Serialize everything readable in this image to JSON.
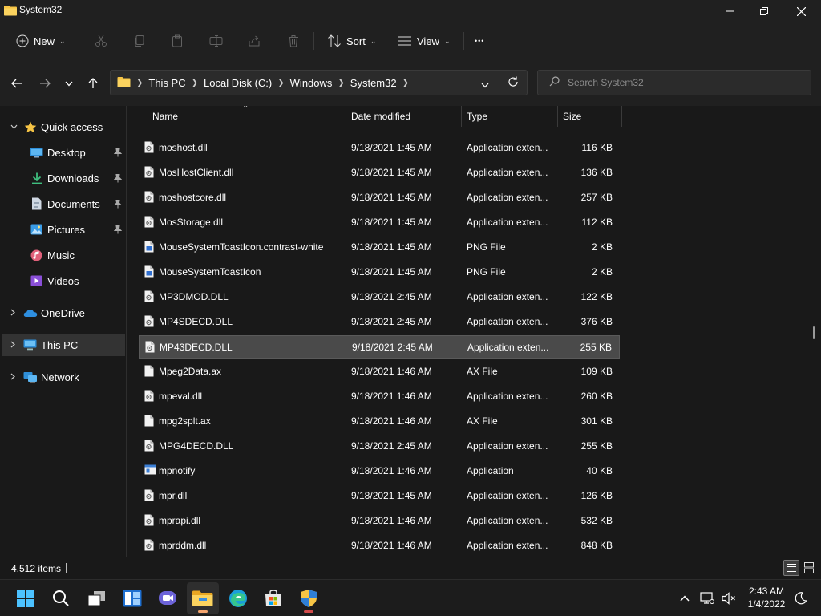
{
  "window": {
    "title": "System32"
  },
  "toolbar": {
    "new_label": "New",
    "sort_label": "Sort",
    "view_label": "View",
    "more_label": "•••"
  },
  "address": {
    "breadcrumbs": [
      "This PC",
      "Local Disk (C:)",
      "Windows",
      "System32"
    ]
  },
  "search": {
    "placeholder": "Search System32"
  },
  "sidebar": {
    "quick_access": "Quick access",
    "items": [
      {
        "label": "Desktop",
        "icon": "desktop-icon",
        "pinned": true
      },
      {
        "label": "Downloads",
        "icon": "download-icon",
        "pinned": true
      },
      {
        "label": "Documents",
        "icon": "documents-icon",
        "pinned": true
      },
      {
        "label": "Pictures",
        "icon": "pictures-icon",
        "pinned": true
      },
      {
        "label": "Music",
        "icon": "music-icon",
        "pinned": false
      },
      {
        "label": "Videos",
        "icon": "videos-icon",
        "pinned": false
      }
    ],
    "onedrive": "OneDrive",
    "this_pc": "This PC",
    "network": "Network"
  },
  "columns": {
    "name": "Name",
    "date": "Date modified",
    "type": "Type",
    "size": "Size"
  },
  "files": [
    {
      "name": "moshost.dll",
      "date": "9/18/2021 1:45 AM",
      "type": "Application exten...",
      "size": "116 KB",
      "icon": "dll-file-icon"
    },
    {
      "name": "MosHostClient.dll",
      "date": "9/18/2021 1:45 AM",
      "type": "Application exten...",
      "size": "136 KB",
      "icon": "dll-file-icon"
    },
    {
      "name": "moshostcore.dll",
      "date": "9/18/2021 1:45 AM",
      "type": "Application exten...",
      "size": "257 KB",
      "icon": "dll-file-icon"
    },
    {
      "name": "MosStorage.dll",
      "date": "9/18/2021 1:45 AM",
      "type": "Application exten...",
      "size": "112 KB",
      "icon": "dll-file-icon"
    },
    {
      "name": "MouseSystemToastIcon.contrast-white",
      "date": "9/18/2021 1:45 AM",
      "type": "PNG File",
      "size": "2 KB",
      "icon": "png-file-icon"
    },
    {
      "name": "MouseSystemToastIcon",
      "date": "9/18/2021 1:45 AM",
      "type": "PNG File",
      "size": "2 KB",
      "icon": "png-file-icon"
    },
    {
      "name": "MP3DMOD.DLL",
      "date": "9/18/2021 2:45 AM",
      "type": "Application exten...",
      "size": "122 KB",
      "icon": "dll-file-icon"
    },
    {
      "name": "MP4SDECD.DLL",
      "date": "9/18/2021 2:45 AM",
      "type": "Application exten...",
      "size": "376 KB",
      "icon": "dll-file-icon"
    },
    {
      "name": "MP43DECD.DLL",
      "date": "9/18/2021 2:45 AM",
      "type": "Application exten...",
      "size": "255 KB",
      "icon": "dll-file-icon",
      "selected": true
    },
    {
      "name": "Mpeg2Data.ax",
      "date": "9/18/2021 1:46 AM",
      "type": "AX File",
      "size": "109 KB",
      "icon": "ax-file-icon"
    },
    {
      "name": "mpeval.dll",
      "date": "9/18/2021 1:46 AM",
      "type": "Application exten...",
      "size": "260 KB",
      "icon": "dll-file-icon"
    },
    {
      "name": "mpg2splt.ax",
      "date": "9/18/2021 1:46 AM",
      "type": "AX File",
      "size": "301 KB",
      "icon": "ax-file-icon"
    },
    {
      "name": "MPG4DECD.DLL",
      "date": "9/18/2021 2:45 AM",
      "type": "Application exten...",
      "size": "255 KB",
      "icon": "dll-file-icon"
    },
    {
      "name": "mpnotify",
      "date": "9/18/2021 1:46 AM",
      "type": "Application",
      "size": "40 KB",
      "icon": "application-icon"
    },
    {
      "name": "mpr.dll",
      "date": "9/18/2021 1:45 AM",
      "type": "Application exten...",
      "size": "126 KB",
      "icon": "dll-file-icon"
    },
    {
      "name": "mprapi.dll",
      "date": "9/18/2021 1:46 AM",
      "type": "Application exten...",
      "size": "532 KB",
      "icon": "dll-file-icon"
    },
    {
      "name": "mprddm.dll",
      "date": "9/18/2021 1:46 AM",
      "type": "Application exten...",
      "size": "848 KB",
      "icon": "dll-file-icon"
    }
  ],
  "status": {
    "item_count": "4,512 items"
  },
  "taskbar": {
    "apps": [
      "start-icon",
      "search-icon",
      "task-view-icon",
      "widgets-icon",
      "teams-chat-icon",
      "file-explorer-icon",
      "edge-icon",
      "store-icon",
      "security-shield-icon"
    ],
    "time": "2:43 AM",
    "date": "1/4/2022"
  },
  "colors": {
    "accent": "#4cc2ff",
    "folder": "#f6c445",
    "selected_row": "#4a4a4a"
  }
}
